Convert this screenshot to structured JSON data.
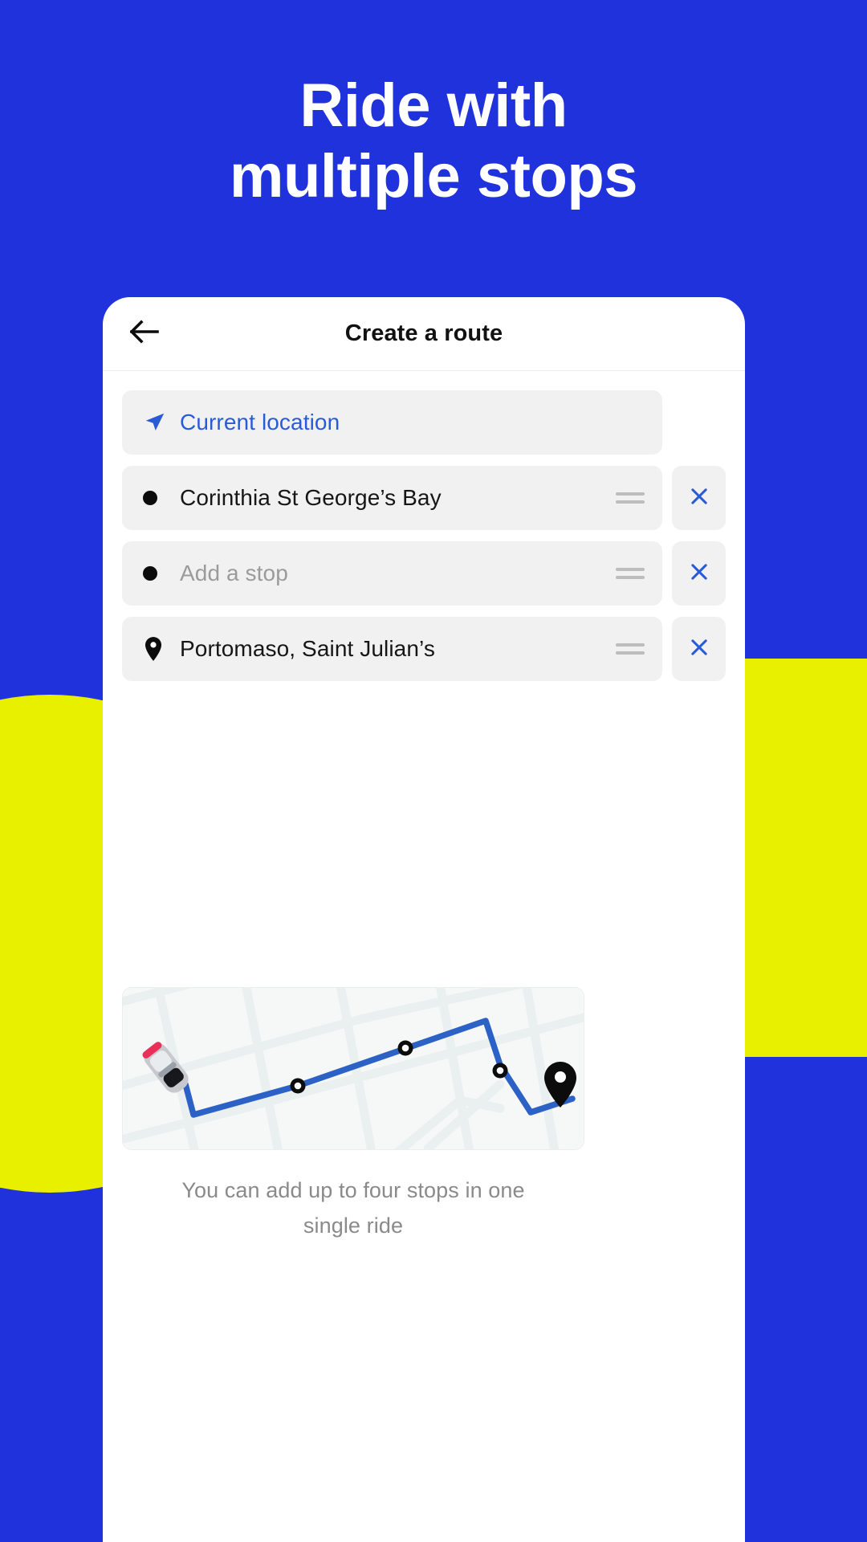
{
  "theme": {
    "brand_blue": "#1f32dc",
    "accent_yellow": "#e8f000",
    "link_blue": "#2a5bd7",
    "route_blue": "#2c62c6",
    "field_gray": "#f1f1f1",
    "placeholder_gray": "#9b9b9b",
    "caption_gray": "#8a8a8a"
  },
  "headline": {
    "line1": "Ride with",
    "line2": "multiple stops"
  },
  "app_bar": {
    "back_icon": "arrow-left-icon",
    "title": "Create a route"
  },
  "stops": [
    {
      "icon": "navigation-arrow-icon",
      "text": "Current location",
      "style": "link",
      "has_drag_handle": false,
      "has_remove": false,
      "remove_label": "×"
    },
    {
      "icon": "dot-icon",
      "text": "Corinthia St George’s Bay",
      "style": "value",
      "has_drag_handle": true,
      "has_remove": true,
      "remove_label": "×"
    },
    {
      "icon": "dot-icon",
      "text": "Add a stop",
      "style": "placeholder",
      "has_drag_handle": true,
      "has_remove": true,
      "remove_label": "×"
    },
    {
      "icon": "map-pin-icon",
      "text": "Portomaso, Saint Julian’s",
      "style": "value",
      "has_drag_handle": true,
      "has_remove": true,
      "remove_label": "×"
    }
  ],
  "map_preview": {
    "name": "route-map-preview",
    "start_marker": "car-icon",
    "waypoint_markers": 3,
    "destination_marker": "map-pin-icon",
    "route_color": "#2c62c6"
  },
  "caption": {
    "line1": "You can add up to four stops in one",
    "line2": "single ride"
  }
}
